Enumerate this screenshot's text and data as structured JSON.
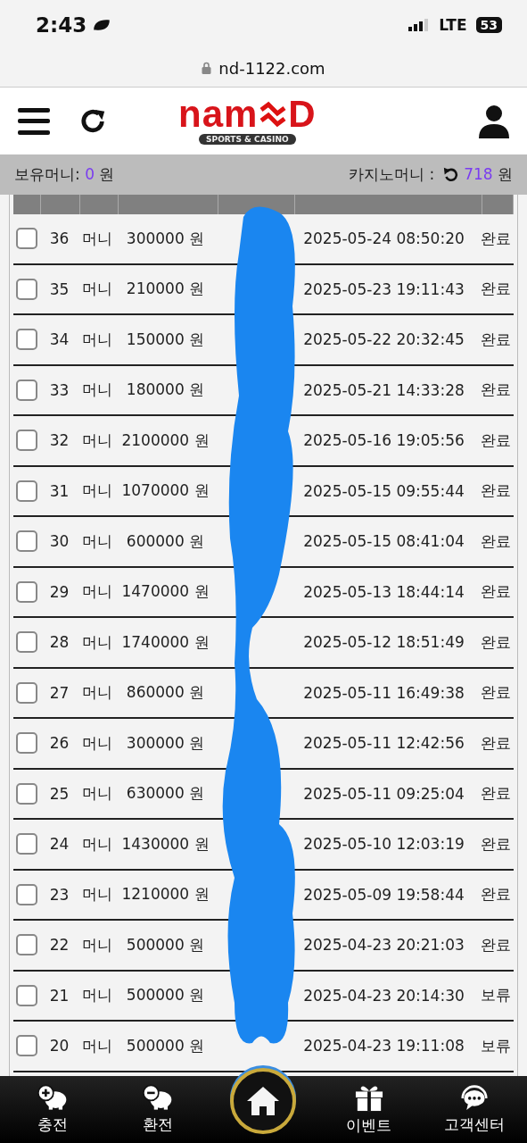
{
  "status_bar": {
    "time": "2:43",
    "network": "LTE",
    "battery": "53"
  },
  "address_bar": {
    "url": "nd-1122.com"
  },
  "header": {
    "logo": {
      "left": "nam",
      "right": "D",
      "tagline": "SPORTS & CASINO"
    }
  },
  "balance_bar": {
    "held_label": "보유머니:",
    "held_amount": "0",
    "held_unit": "원",
    "casino_label": "카지노머니 :",
    "casino_amount": "718",
    "casino_unit": "원"
  },
  "table": {
    "rows": [
      {
        "checked": false,
        "number": "36",
        "type": "머니",
        "amount": "300000 원",
        "datetime": "2025-05-24 08:50:20",
        "status": "완료"
      },
      {
        "checked": false,
        "number": "35",
        "type": "머니",
        "amount": "210000 원",
        "datetime": "2025-05-23 19:11:43",
        "status": "완료"
      },
      {
        "checked": false,
        "number": "34",
        "type": "머니",
        "amount": "150000 원",
        "datetime": "2025-05-22 20:32:45",
        "status": "완료"
      },
      {
        "checked": false,
        "number": "33",
        "type": "머니",
        "amount": "180000 원",
        "datetime": "2025-05-21 14:33:28",
        "status": "완료"
      },
      {
        "checked": false,
        "number": "32",
        "type": "머니",
        "amount": "2100000 원",
        "datetime": "2025-05-16 19:05:56",
        "status": "완료"
      },
      {
        "checked": false,
        "number": "31",
        "type": "머니",
        "amount": "1070000 원",
        "datetime": "2025-05-15 09:55:44",
        "status": "완료"
      },
      {
        "checked": false,
        "number": "30",
        "type": "머니",
        "amount": "600000 원",
        "datetime": "2025-05-15 08:41:04",
        "status": "완료"
      },
      {
        "checked": false,
        "number": "29",
        "type": "머니",
        "amount": "1470000 원",
        "datetime": "2025-05-13 18:44:14",
        "status": "완료"
      },
      {
        "checked": false,
        "number": "28",
        "type": "머니",
        "amount": "1740000 원",
        "datetime": "2025-05-12 18:51:49",
        "status": "완료"
      },
      {
        "checked": false,
        "number": "27",
        "type": "머니",
        "amount": "860000 원",
        "datetime": "2025-05-11 16:49:38",
        "status": "완료"
      },
      {
        "checked": false,
        "number": "26",
        "type": "머니",
        "amount": "300000 원",
        "datetime": "2025-05-11 12:42:56",
        "status": "완료"
      },
      {
        "checked": false,
        "number": "25",
        "type": "머니",
        "amount": "630000 원",
        "datetime": "2025-05-11 09:25:04",
        "status": "완료"
      },
      {
        "checked": false,
        "number": "24",
        "type": "머니",
        "amount": "1430000 원",
        "datetime": "2025-05-10 12:03:19",
        "status": "완료"
      },
      {
        "checked": false,
        "number": "23",
        "type": "머니",
        "amount": "1210000 원",
        "datetime": "2025-05-09 19:58:44",
        "status": "완료"
      },
      {
        "checked": false,
        "number": "22",
        "type": "머니",
        "amount": "500000 원",
        "datetime": "2025-04-23 20:21:03",
        "status": "완료"
      },
      {
        "checked": false,
        "number": "21",
        "type": "머니",
        "amount": "500000 원",
        "datetime": "2025-04-23 20:14:30",
        "status": "보류"
      },
      {
        "checked": false,
        "number": "20",
        "type": "머니",
        "amount": "500000 원",
        "datetime": "2025-04-23 19:11:08",
        "status": "보류"
      }
    ]
  },
  "bottom_nav": [
    {
      "label": "충전",
      "kind": "deposit"
    },
    {
      "label": "환전",
      "kind": "withdraw"
    },
    {
      "kind": "home"
    },
    {
      "label": "이벤트",
      "kind": "event"
    },
    {
      "label": "고객센터",
      "kind": "support"
    }
  ]
}
